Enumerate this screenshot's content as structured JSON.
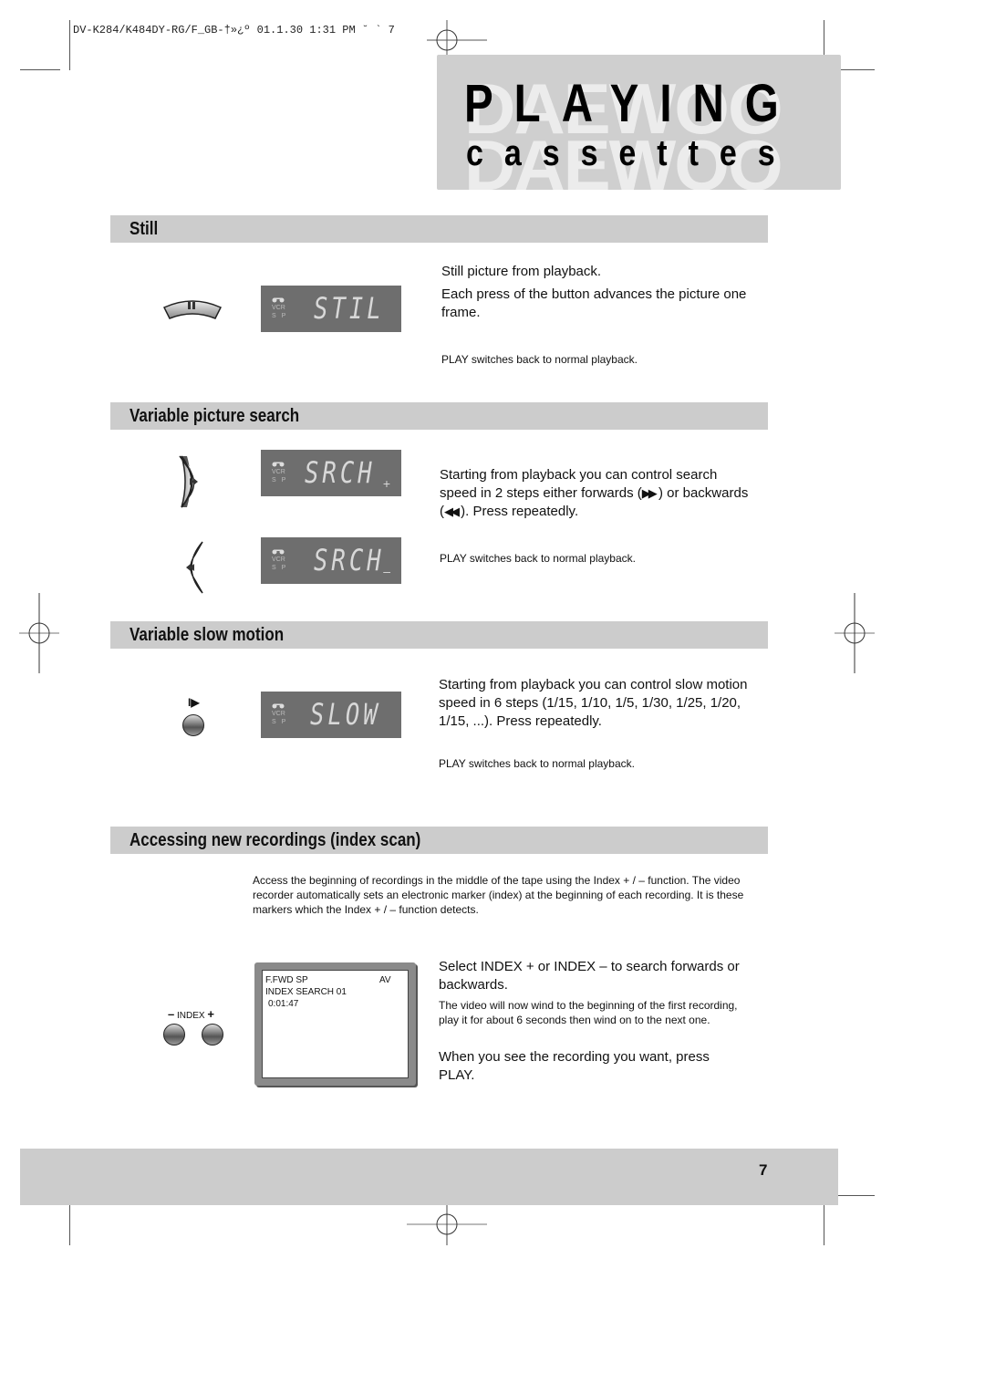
{
  "print_header": "DV-K284/K484DY-RG/F_GB-†»¿º  01.1.30 1:31 PM  ˘  `  7",
  "title": {
    "main": "PLAYING",
    "sub": "cassettes",
    "watermark": "DAEWOO"
  },
  "sections": {
    "still": {
      "heading": "Still",
      "button_icon": "pause-button",
      "display": {
        "indicator_vcr": "VCR",
        "indicator_sp": "S P",
        "text": "STIL",
        "sign": ""
      },
      "text1": "Still picture from playback.",
      "text2": "Each press of the button advances the picture one frame.",
      "note": "PLAY switches back to normal playback."
    },
    "search": {
      "heading": "Variable picture search",
      "display_fwd": {
        "indicator_vcr": "VCR",
        "indicator_sp": "S P",
        "text": "SRCH",
        "sign": "+"
      },
      "display_rew": {
        "indicator_vcr": "VCR",
        "indicator_sp": "S P",
        "text": "SRCH",
        "sign": "–"
      },
      "text_part1": "Starting from playback you can control search speed in 2 steps either forwards (",
      "text_part2": " ) or backwards (",
      "text_part3": " ). Press repeatedly.",
      "note": "PLAY switches back to normal playback."
    },
    "slow": {
      "heading": "Variable slow motion",
      "button_symbol": "I▶",
      "display": {
        "indicator_vcr": "VCR",
        "indicator_sp": "S P",
        "text": "SLOW",
        "sign": ""
      },
      "text": "Starting from playback you can control slow motion speed in 6 steps (1/15, 1/10, 1/5, 1/30, 1/25, 1/20, 1/15, ...). Press repeatedly.",
      "note": "PLAY switches back to normal playback."
    },
    "index": {
      "heading": "Accessing new recordings (index scan)",
      "intro": "Access the beginning of recordings in the middle of the tape using the Index + / – function. The video recorder automatically sets an electronic marker (index) at the beginning of each recording. It is these markers which the Index + / – function detects.",
      "button_label_minus": "–",
      "button_label": "INDEX",
      "button_label_plus": "+",
      "osd": {
        "line1_left": "F.FWD  SP",
        "line1_right": "AV",
        "line2": "INDEX SEARCH  01",
        "line3": "0:01:47"
      },
      "step1": "Select INDEX + or INDEX – to search forwards or backwards.",
      "step1_detail": "The video will now wind to the beginning of the first recording, play it for about 6 seconds then wind on to the next one.",
      "step2": "When you see the recording you want, press PLAY."
    }
  },
  "footer": {
    "page_number": "7"
  }
}
